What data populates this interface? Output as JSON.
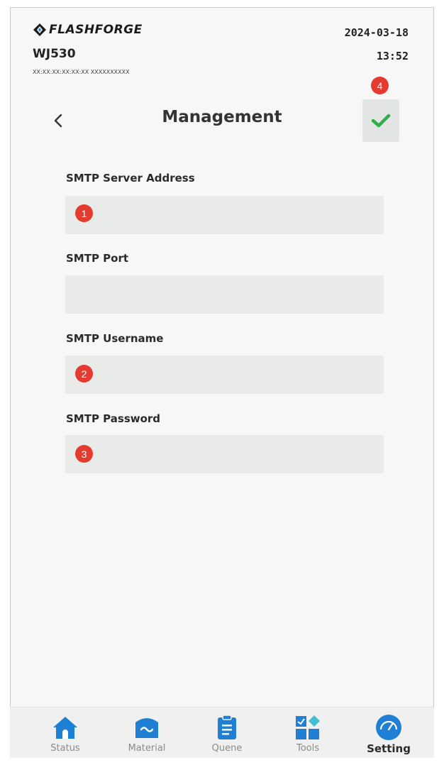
{
  "header": {
    "brand": "FLASHFORGE",
    "device_name": "WJ530",
    "mac_serial": "XX:XX:XX:XX:XX:XX   XXXXXXXXXX",
    "date": "2024-03-18",
    "time": "13:52"
  },
  "page": {
    "title": "Management"
  },
  "badges": {
    "server": "1",
    "username": "2",
    "password": "3",
    "confirm": "4"
  },
  "form": {
    "server_address": {
      "label": "SMTP Server Address",
      "value": "",
      "placeholder": ""
    },
    "port": {
      "label": "SMTP Port",
      "value": "",
      "placeholder": ""
    },
    "username": {
      "label": "SMTP Username",
      "value": "",
      "placeholder": ""
    },
    "password": {
      "label": "SMTP Password",
      "value": "",
      "placeholder": ""
    }
  },
  "nav": {
    "items": [
      {
        "label": "Status",
        "icon": "home-icon"
      },
      {
        "label": "Material",
        "icon": "material-icon"
      },
      {
        "label": "Quene",
        "icon": "queue-clipboard-icon"
      },
      {
        "label": "Tools",
        "icon": "tools-grid-icon"
      },
      {
        "label": "Setting",
        "icon": "setting-gauge-icon"
      }
    ],
    "active_index": 4
  },
  "colors": {
    "accent": "#1e7fd4",
    "badge": "#e53a2f",
    "check": "#2fae4a",
    "field_bg": "#e9ebe9"
  }
}
